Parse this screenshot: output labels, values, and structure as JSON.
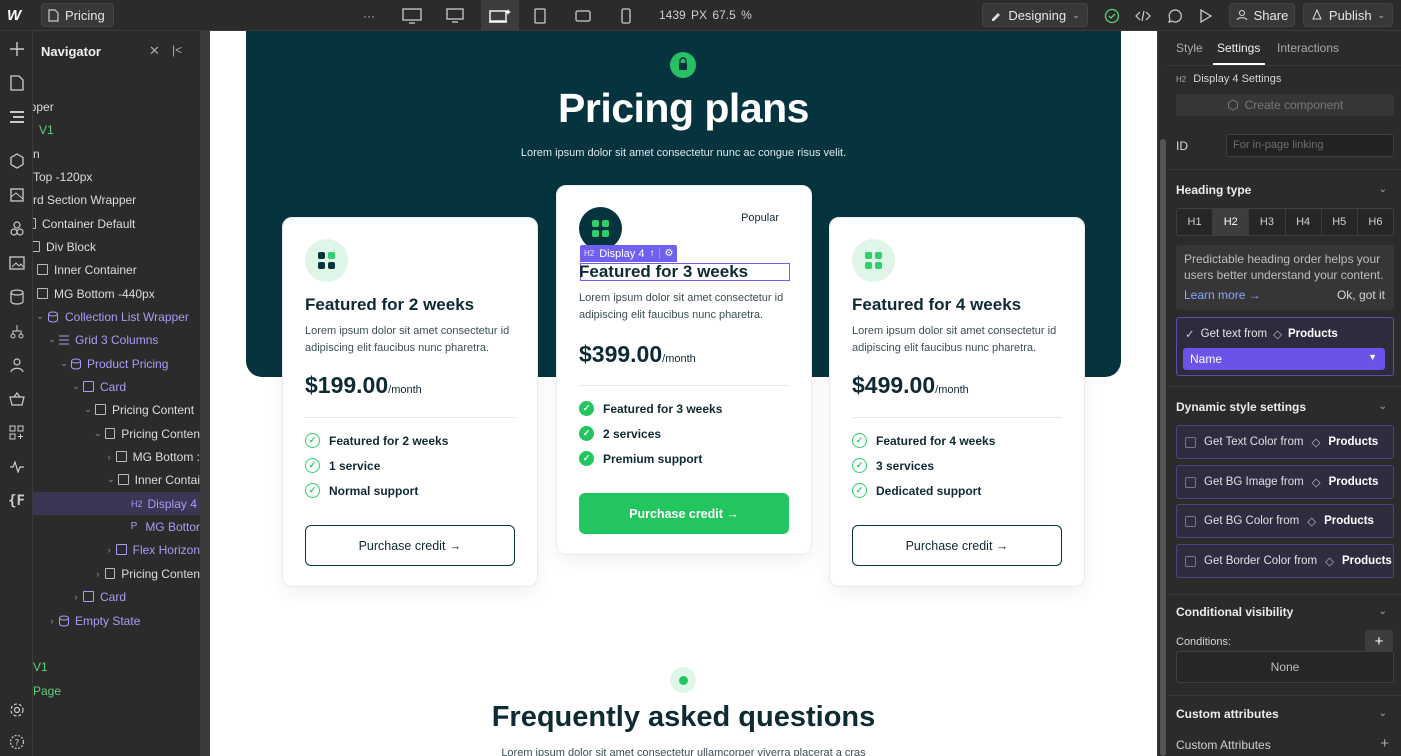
{
  "topbar": {
    "page_name": "Pricing",
    "width_label": "1439 PX",
    "zoom_label": "67.5 %",
    "mode_label": "Designing",
    "share_label": "Share",
    "publish_label": "Publish",
    "more_label": "···"
  },
  "navigator": {
    "title": "Navigator",
    "items": [
      {
        "label": "ipper"
      },
      {
        "label": "V1"
      },
      {
        "label": "n"
      },
      {
        "label": "Top -120px"
      },
      {
        "label": "rd Section Wrapper"
      },
      {
        "label": "Container Default"
      },
      {
        "label": "Div Block"
      },
      {
        "label": "Inner Container"
      },
      {
        "label": "MG Bottom -440px"
      },
      {
        "label": "Collection List Wrapper"
      },
      {
        "label": "Grid 3 Columns"
      },
      {
        "label": "Product Pricing"
      },
      {
        "label": "Card"
      },
      {
        "label": "Pricing Content"
      },
      {
        "label": "Pricing Conten"
      },
      {
        "label": "MG Bottom :"
      },
      {
        "label": "Inner Contai"
      },
      {
        "label": "Display 4"
      },
      {
        "label": "MG Bottor"
      },
      {
        "label": "Flex Horizon"
      },
      {
        "label": "Pricing Conten"
      },
      {
        "label": "Card"
      },
      {
        "label": "Empty State"
      },
      {
        "label": "V1"
      },
      {
        "label": "Page"
      }
    ],
    "h2_tag": "H2",
    "p_tag": "P"
  },
  "canvas": {
    "hero_title": "Pricing plans",
    "hero_sub": "Lorem ipsum dolor sit amet consectetur nunc ac congue risus velit.",
    "selection_tag": "Display 4",
    "selection_h2": "H2",
    "popular_label": "Popular",
    "cards": [
      {
        "title": "Featured for 2 weeks",
        "desc": "Lorem ipsum dolor sit amet consectetur id adipiscing elit faucibus nunc pharetra.",
        "price": "$199.00",
        "period": "/month",
        "features": [
          "Featured for 2 weeks",
          "1 service",
          "Normal support"
        ],
        "button": "Purchase credit →"
      },
      {
        "title": "Featured for 3 weeks",
        "desc": "Lorem ipsum dolor sit amet consectetur id adipiscing elit faucibus nunc pharetra.",
        "price": "$399.00",
        "period": "/month",
        "features": [
          "Featured for 3 weeks",
          "2 services",
          "Premium support"
        ],
        "button": "Purchase credit →"
      },
      {
        "title": "Featured for 4 weeks",
        "desc": "Lorem ipsum dolor sit amet consectetur id adipiscing elit faucibus nunc pharetra.",
        "price": "$499.00",
        "period": "/month",
        "features": [
          "Featured for 4 weeks",
          "3 services",
          "Dedicated support"
        ],
        "button": "Purchase credit →"
      }
    ],
    "faq_title": "Frequently asked questions",
    "faq_sub": "Lorem ipsum dolor sit amet consectetur ullamcorper viverra placerat a cras"
  },
  "panel": {
    "tabs": [
      "Style",
      "Settings",
      "Interactions"
    ],
    "element_tag": "H2",
    "element_label": "Display 4 Settings",
    "create_component": "Create component",
    "id_label": "ID",
    "id_placeholder": "For in-page linking",
    "heading_type_title": "Heading type",
    "heading_levels": [
      "H1",
      "H2",
      "H3",
      "H4",
      "H5",
      "H6"
    ],
    "hint_text": "Predictable heading order helps your users better understand your content.",
    "learn_more": "Learn more →",
    "ok_got_it": "Ok, got it",
    "get_text_from": "Get text from",
    "products": "Products",
    "field_value": "Name",
    "dynamic_title": "Dynamic style settings",
    "dynamic_rows": [
      {
        "label": "Get Text Color from",
        "src": "Products"
      },
      {
        "label": "Get BG Image from",
        "src": "Products"
      },
      {
        "label": "Get BG Color from",
        "src": "Products"
      },
      {
        "label": "Get Border Color from",
        "src": "Products"
      }
    ],
    "cond_title": "Conditional visibility",
    "conditions_label": "Conditions:",
    "conditions_value": "None",
    "custom_title": "Custom attributes",
    "custom_attr_label": "Custom Attributes"
  }
}
